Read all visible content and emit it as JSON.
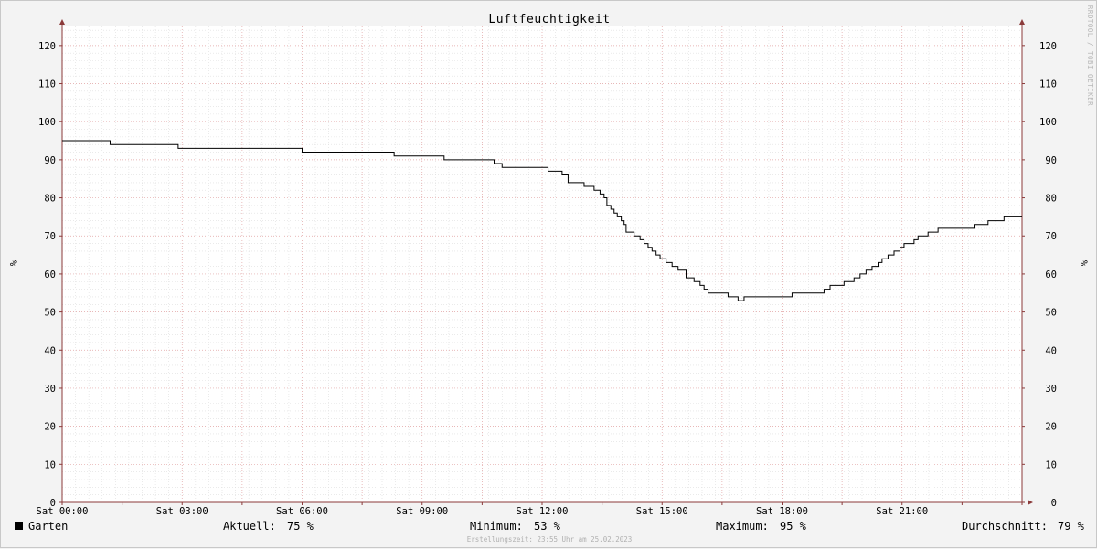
{
  "chart_data": {
    "type": "line",
    "title": "Luftfeuchtigkeit",
    "ylabel": "%",
    "ylim": [
      0,
      125
    ],
    "y_ticks": [
      0,
      10,
      20,
      30,
      40,
      50,
      60,
      70,
      80,
      90,
      100,
      110,
      120
    ],
    "x_range_hours": [
      0,
      24
    ],
    "x_ticks": [
      {
        "hour": 0,
        "label": "Sat 00:00"
      },
      {
        "hour": 3,
        "label": "Sat 03:00"
      },
      {
        "hour": 6,
        "label": "Sat 06:00"
      },
      {
        "hour": 9,
        "label": "Sat 09:00"
      },
      {
        "hour": 12,
        "label": "Sat 12:00"
      },
      {
        "hour": 15,
        "label": "Sat 15:00"
      },
      {
        "hour": 18,
        "label": "Sat 18:00"
      },
      {
        "hour": 21,
        "label": "Sat 21:00"
      }
    ],
    "grid": true,
    "series": [
      {
        "name": "Garten",
        "color": "#000000",
        "points": [
          [
            0.0,
            95
          ],
          [
            1.2,
            94
          ],
          [
            2.9,
            93
          ],
          [
            6.0,
            92
          ],
          [
            8.3,
            91
          ],
          [
            9.55,
            90
          ],
          [
            10.8,
            89
          ],
          [
            11.0,
            88
          ],
          [
            12.15,
            87
          ],
          [
            12.5,
            86
          ],
          [
            12.65,
            84
          ],
          [
            13.05,
            83
          ],
          [
            13.3,
            82
          ],
          [
            13.45,
            81
          ],
          [
            13.55,
            80
          ],
          [
            13.62,
            78
          ],
          [
            13.72,
            77
          ],
          [
            13.8,
            76
          ],
          [
            13.88,
            75
          ],
          [
            13.98,
            74
          ],
          [
            14.05,
            73
          ],
          [
            14.1,
            71
          ],
          [
            14.3,
            70
          ],
          [
            14.45,
            69
          ],
          [
            14.55,
            68
          ],
          [
            14.65,
            67
          ],
          [
            14.75,
            66
          ],
          [
            14.85,
            65
          ],
          [
            14.95,
            64
          ],
          [
            15.1,
            63
          ],
          [
            15.25,
            62
          ],
          [
            15.4,
            61
          ],
          [
            15.6,
            59
          ],
          [
            15.8,
            58
          ],
          [
            15.95,
            57
          ],
          [
            16.05,
            56
          ],
          [
            16.15,
            55
          ],
          [
            16.65,
            54
          ],
          [
            16.9,
            53
          ],
          [
            17.05,
            54
          ],
          [
            18.25,
            55
          ],
          [
            19.05,
            56
          ],
          [
            19.2,
            57
          ],
          [
            19.55,
            58
          ],
          [
            19.8,
            59
          ],
          [
            19.95,
            60
          ],
          [
            20.1,
            61
          ],
          [
            20.25,
            62
          ],
          [
            20.4,
            63
          ],
          [
            20.5,
            64
          ],
          [
            20.65,
            65
          ],
          [
            20.8,
            66
          ],
          [
            20.95,
            67
          ],
          [
            21.05,
            68
          ],
          [
            21.3,
            69
          ],
          [
            21.4,
            70
          ],
          [
            21.65,
            71
          ],
          [
            21.9,
            72
          ],
          [
            22.8,
            73
          ],
          [
            23.15,
            74
          ],
          [
            23.55,
            75
          ],
          [
            24.0,
            75
          ]
        ]
      }
    ],
    "legend": {
      "series_name": "Garten",
      "aktuell_label": "Aktuell:",
      "aktuell_value": "75 %",
      "minimum_label": "Minimum:",
      "minimum_value": "53 %",
      "maximum_label": "Maximum:",
      "maximum_value": "95 %",
      "durchschnitt_label": "Durchschnitt:",
      "durchschnitt_value": "79 %"
    },
    "footer": "Erstellungszeit: 23:55 Uhr am 25.02.2023",
    "watermark": "RRDTOOL / TOBI OETIKER",
    "colors": {
      "background": "#f3f3f3",
      "canvas": "#ffffff",
      "major_grid": "#e0a0a0",
      "minor_grid": "#dddddd",
      "axis": "#8b3a3a",
      "line": "#000000"
    }
  }
}
